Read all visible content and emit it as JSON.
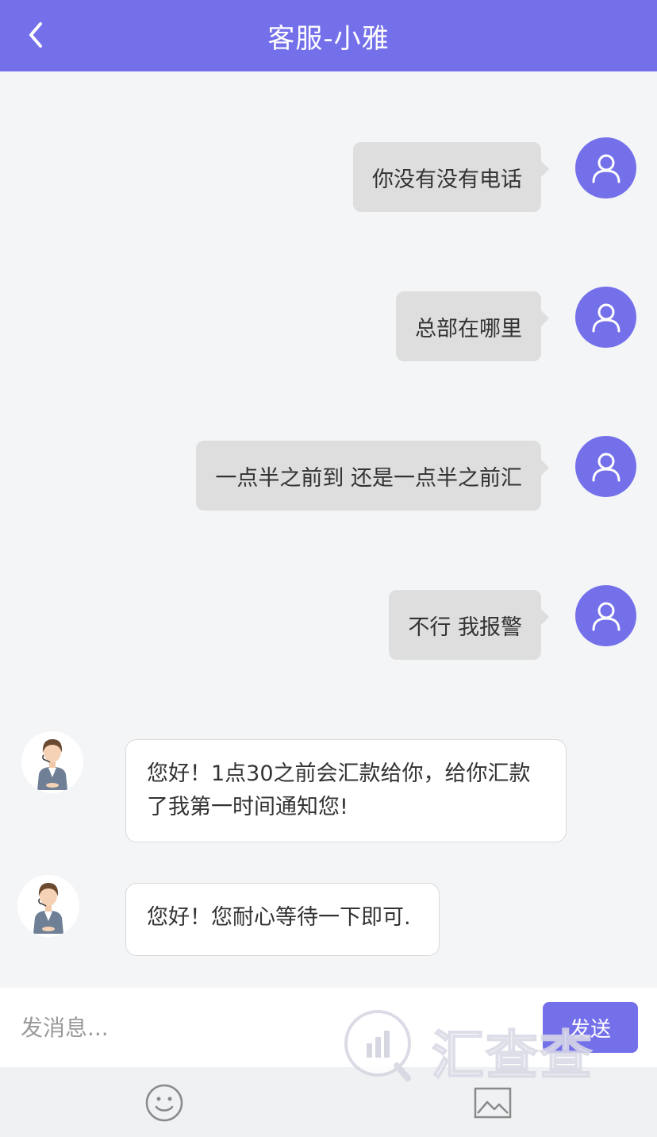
{
  "header": {
    "title": "客服-小雅"
  },
  "messages_out": [
    {
      "text": "你没有没有电话"
    },
    {
      "text": "总部在哪里"
    },
    {
      "text": "一点半之前到 还是一点半之前汇"
    },
    {
      "text": "不行 我报警"
    }
  ],
  "messages_in": [
    {
      "text": "您好！1点30之前会汇款给你，给你汇款了我第一时间通知您!"
    },
    {
      "text": "您好！您耐心等待一下即可."
    }
  ],
  "composer": {
    "placeholder": "发消息...",
    "send_label": "发送"
  },
  "toolbar": {
    "emoji_icon": "smiley-icon",
    "image_icon": "image-icon"
  },
  "watermark": {
    "text": "汇查查"
  },
  "colors": {
    "accent": "#7470ea",
    "bubble_out": "#dedede",
    "bubble_in": "#ffffff",
    "background": "#f4f5f7"
  }
}
